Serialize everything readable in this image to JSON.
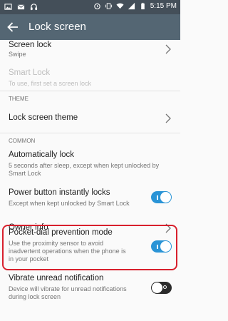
{
  "status_bar": {
    "time": "5:15 PM",
    "icons": [
      "image-icon",
      "mail-icon",
      "headphones-icon",
      "alarm-icon",
      "vibrate-icon",
      "wifi-icon",
      "signal-icon",
      "battery-icon"
    ]
  },
  "app_bar": {
    "title": "Lock screen",
    "back_icon": "arrow-left-icon"
  },
  "settings": {
    "screen_lock": {
      "title": "Screen lock",
      "summary": "Swipe"
    },
    "smart_lock": {
      "title": "Smart Lock",
      "summary": "To use, first set a screen lock",
      "enabled": false
    },
    "theme_header": "THEME",
    "lock_screen_theme": {
      "title": "Lock screen theme"
    },
    "common_header": "COMMON",
    "automatically_lock": {
      "title": "Automatically lock",
      "summary_line1": "5 seconds after sleep, except when kept unlocked by",
      "summary_line2": "Smart Lock"
    },
    "power_button_lock": {
      "title": "Power button instantly locks",
      "summary": "Except when kept unlocked by Smart Lock",
      "on": true
    },
    "owner_info": {
      "title": "Owner info"
    },
    "pocket_dial": {
      "title": "Pocket-dial prevention mode",
      "summary_line1": "Use the proximity sensor to avoid",
      "summary_line2": "inadvertent operations when the phone is",
      "summary_line3": "in your pocket",
      "on": true
    },
    "vibrate_unread": {
      "title": "Vibrate unread notification",
      "summary_line1": "Device will vibrate for unread notifications",
      "summary_line2": "during lock screen",
      "on": false
    }
  },
  "colors": {
    "status_bar": "#444f59",
    "app_bar": "#546673",
    "toggle_on": "#2a94d6",
    "highlight": "#d8202d"
  }
}
